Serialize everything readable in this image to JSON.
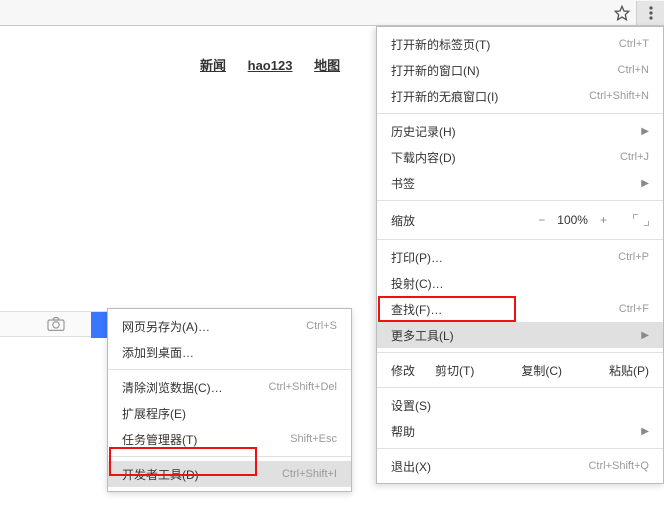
{
  "nav": {
    "news": "新闻",
    "hao": "hao123",
    "map": "地图"
  },
  "main_menu": {
    "new_tab": {
      "label": "打开新的标签页(T)",
      "shortcut": "Ctrl+T"
    },
    "new_window": {
      "label": "打开新的窗口(N)",
      "shortcut": "Ctrl+N"
    },
    "new_incognito": {
      "label": "打开新的无痕窗口(I)",
      "shortcut": "Ctrl+Shift+N"
    },
    "history": {
      "label": "历史记录(H)"
    },
    "downloads": {
      "label": "下载内容(D)",
      "shortcut": "Ctrl+J"
    },
    "bookmarks": {
      "label": "书签"
    },
    "zoom": {
      "label": "缩放",
      "pct": "100%"
    },
    "print": {
      "label": "打印(P)…",
      "shortcut": "Ctrl+P"
    },
    "cast": {
      "label": "投射(C)…"
    },
    "find": {
      "label": "查找(F)…",
      "shortcut": "Ctrl+F"
    },
    "more_tools": {
      "label": "更多工具(L)"
    },
    "edit": {
      "label": "修改",
      "cut": "剪切(T)",
      "copy": "复制(C)",
      "paste": "粘贴(P)"
    },
    "settings": {
      "label": "设置(S)"
    },
    "help": {
      "label": "帮助"
    },
    "exit": {
      "label": "退出(X)",
      "shortcut": "Ctrl+Shift+Q"
    }
  },
  "sub_menu": {
    "save_as": {
      "label": "网页另存为(A)…",
      "shortcut": "Ctrl+S"
    },
    "add_desktop": {
      "label": "添加到桌面…"
    },
    "clear_data": {
      "label": "清除浏览数据(C)…",
      "shortcut": "Ctrl+Shift+Del"
    },
    "extensions": {
      "label": "扩展程序(E)"
    },
    "task_manager": {
      "label": "任务管理器(T)",
      "shortcut": "Shift+Esc"
    },
    "dev_tools": {
      "label": "开发者工具(D)",
      "shortcut": "Ctrl+Shift+I"
    }
  }
}
